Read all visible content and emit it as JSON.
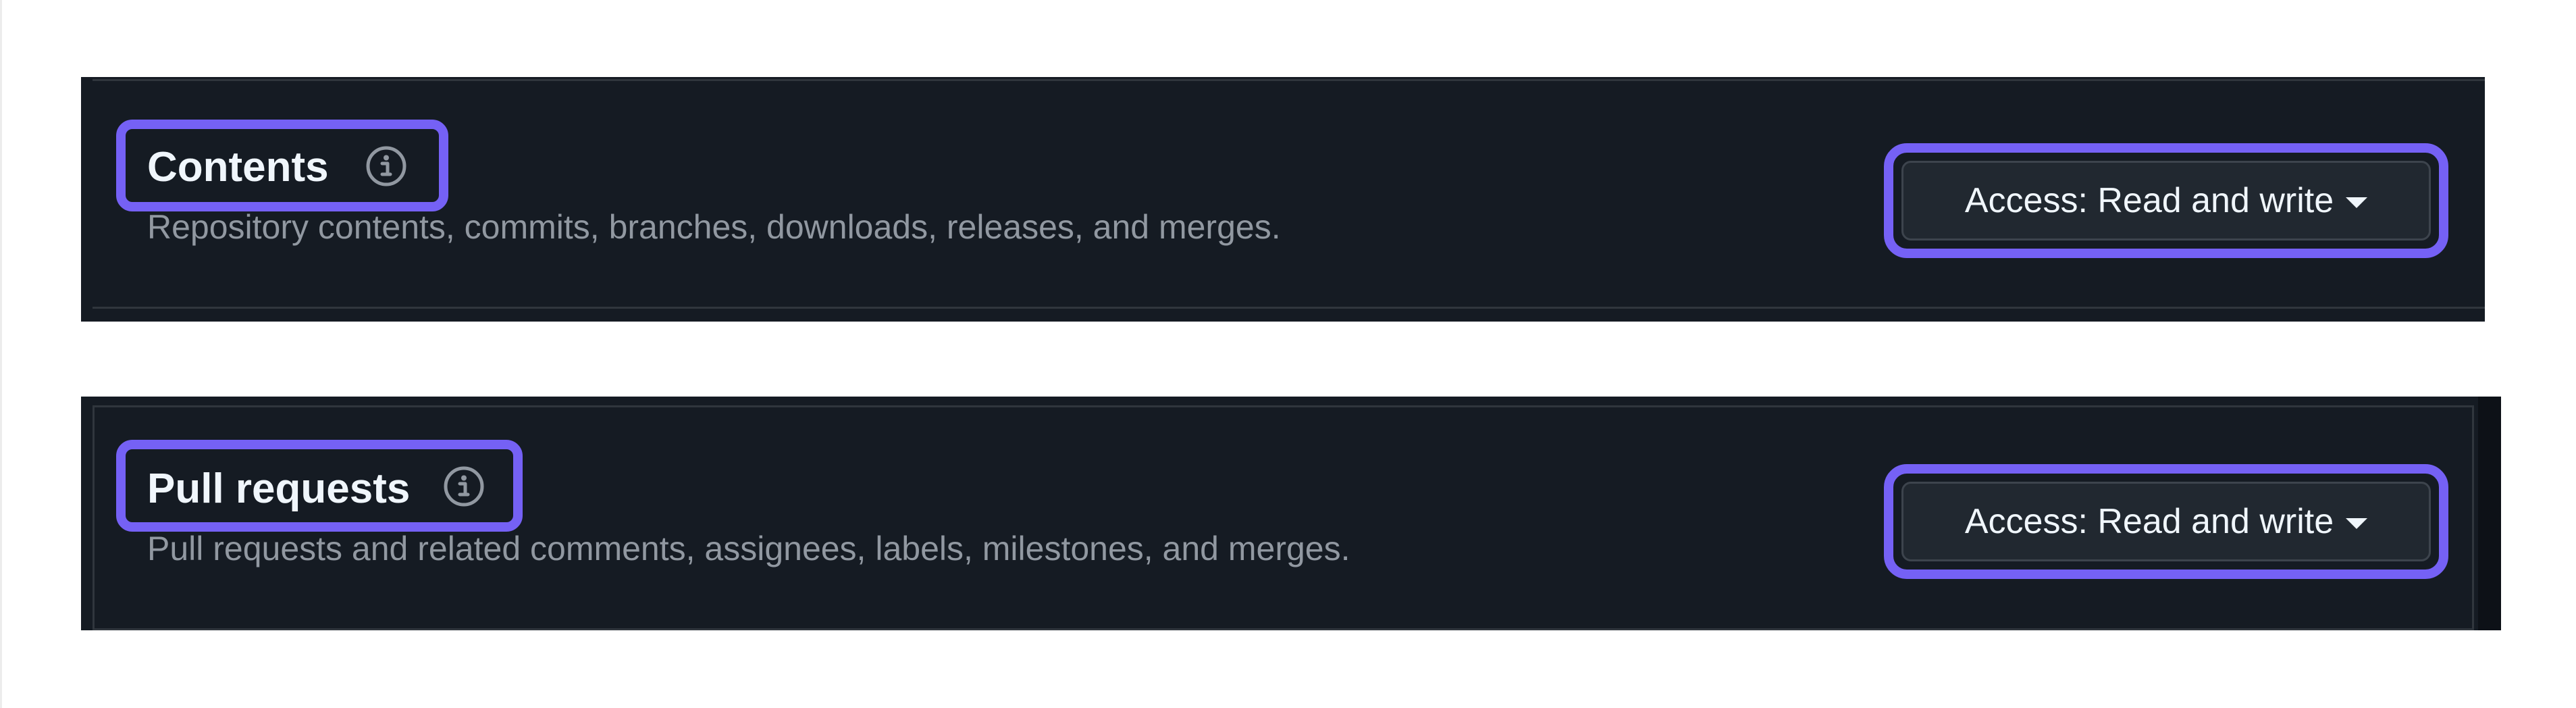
{
  "permissions": [
    {
      "title": "Contents",
      "description": "Repository contents, commits, branches, downloads, releases, and merges.",
      "access_label": "Access: Read and write",
      "info_icon": "info-circle-icon",
      "dropdown_icon": "caret-down-icon"
    },
    {
      "title": "Pull requests",
      "description": "Pull requests and related comments, assignees, labels, milestones, and merges.",
      "access_label": "Access: Read and write",
      "info_icon": "info-circle-icon",
      "dropdown_icon": "caret-down-icon"
    }
  ],
  "colors": {
    "panel_background": "#151b23",
    "highlight": "#7561f5",
    "title_text": "#f0f6fc",
    "description_text": "#9198a1",
    "button_background": "#212830"
  }
}
